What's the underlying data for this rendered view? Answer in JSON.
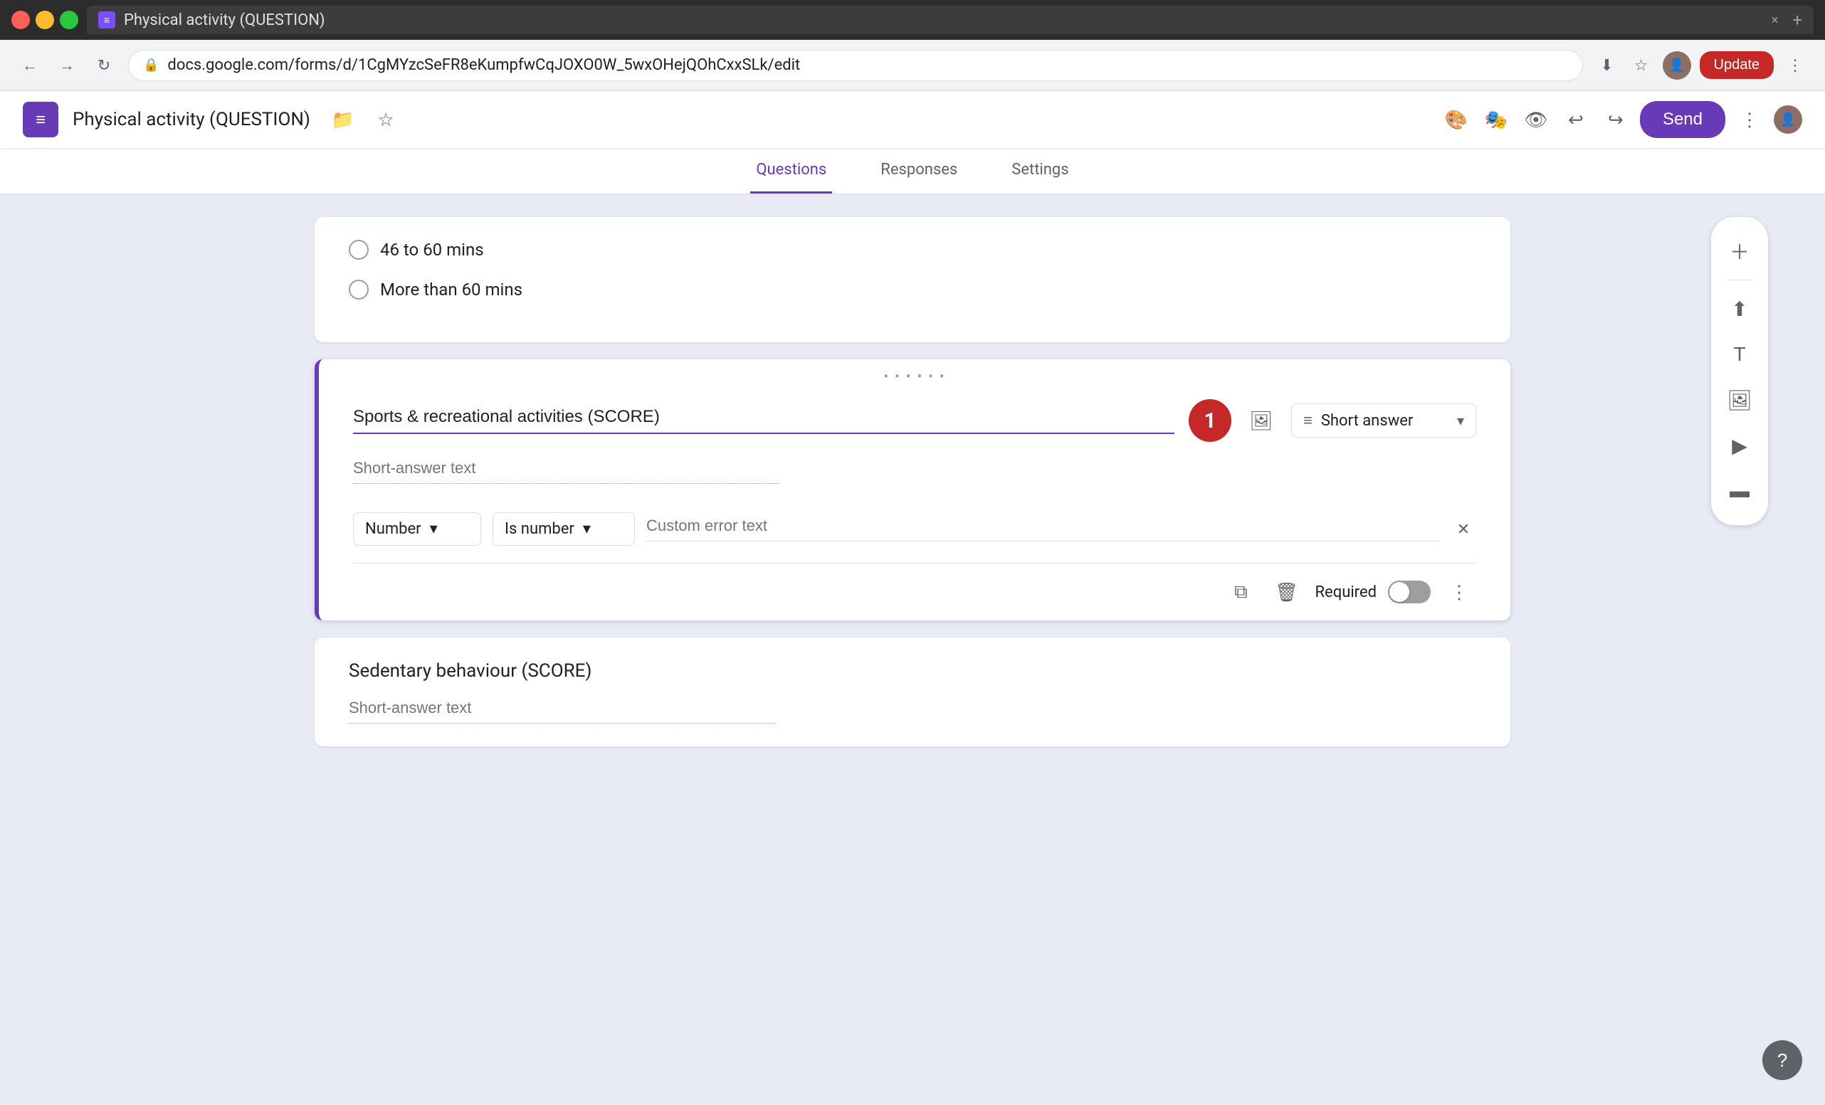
{
  "browser": {
    "titlebar": {
      "tab_title": "Physical activity (QUESTION)",
      "tab_close": "×",
      "tab_new": "+"
    },
    "toolbar": {
      "url": "docs.google.com/forms/d/1CgMYzcSeFR8eKumpfwCqJOXO0W_5wxOHejQOhCxxSLk/edit",
      "update_label": "Update"
    }
  },
  "app": {
    "logo_icon": "≡",
    "title": "Physical activity (QUESTION)",
    "send_label": "Send",
    "tabs": [
      {
        "id": "questions",
        "label": "Questions",
        "active": true
      },
      {
        "id": "responses",
        "label": "Responses",
        "active": false
      },
      {
        "id": "settings",
        "label": "Settings",
        "active": false
      }
    ]
  },
  "previous_question": {
    "options": [
      {
        "label": "46 to 60 mins"
      },
      {
        "label": "More than 60 mins"
      }
    ]
  },
  "active_question": {
    "drag_handle": "⠿",
    "badge_number": "1",
    "question_title": "Sports & recreational activities (SCORE)",
    "type_icon": "≡",
    "type_label": "Short answer",
    "placeholder_text": "Short-answer text",
    "validation": {
      "type_label": "Number",
      "condition_label": "Is number",
      "error_placeholder": "Custom error text"
    },
    "required_label": "Required"
  },
  "next_question": {
    "title": "Sedentary behaviour (SCORE)",
    "placeholder_text": "Short-answer text"
  },
  "sidebar": {
    "icons": [
      {
        "id": "add",
        "symbol": "+"
      },
      {
        "id": "import",
        "symbol": "⬆"
      },
      {
        "id": "title",
        "symbol": "T"
      },
      {
        "id": "image",
        "symbol": "🖼"
      },
      {
        "id": "video",
        "symbol": "▶"
      },
      {
        "id": "section",
        "symbol": "⬛"
      }
    ]
  }
}
